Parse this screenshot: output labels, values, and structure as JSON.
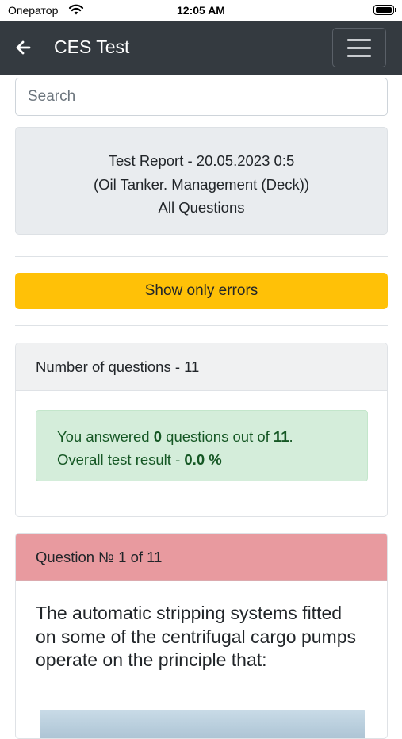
{
  "status_bar": {
    "carrier": "Оператор",
    "time": "12:05 AM"
  },
  "navbar": {
    "title": "CES Test",
    "back_icon": "arrow-left-icon",
    "menu_icon": "hamburger-menu-icon"
  },
  "search": {
    "placeholder": "Search"
  },
  "report": {
    "line1": "Test Report - 20.05.2023 0:5",
    "line2": "(Oil Tanker. Management (Deck))",
    "line3": "All Questions"
  },
  "errors_button": {
    "label": "Show only errors",
    "color": "#ffc107"
  },
  "summary": {
    "header": "Number of questions - 11",
    "answered_prefix": "You answered ",
    "answered_count": "0",
    "answered_middle": " questions out of ",
    "total": "11",
    "answered_suffix": ".",
    "result_prefix": "Overall test result - ",
    "result_value": "0.0 %"
  },
  "question": {
    "header": "Question № 1 of 11",
    "text": "The automatic stripping systems fitted on some of the centrifugal cargo pumps operate on the principle that:",
    "header_color": "#e89a9f"
  },
  "colors": {
    "navbar": "#343a40",
    "alert_bg": "#d4edda",
    "alert_text": "#155724"
  }
}
